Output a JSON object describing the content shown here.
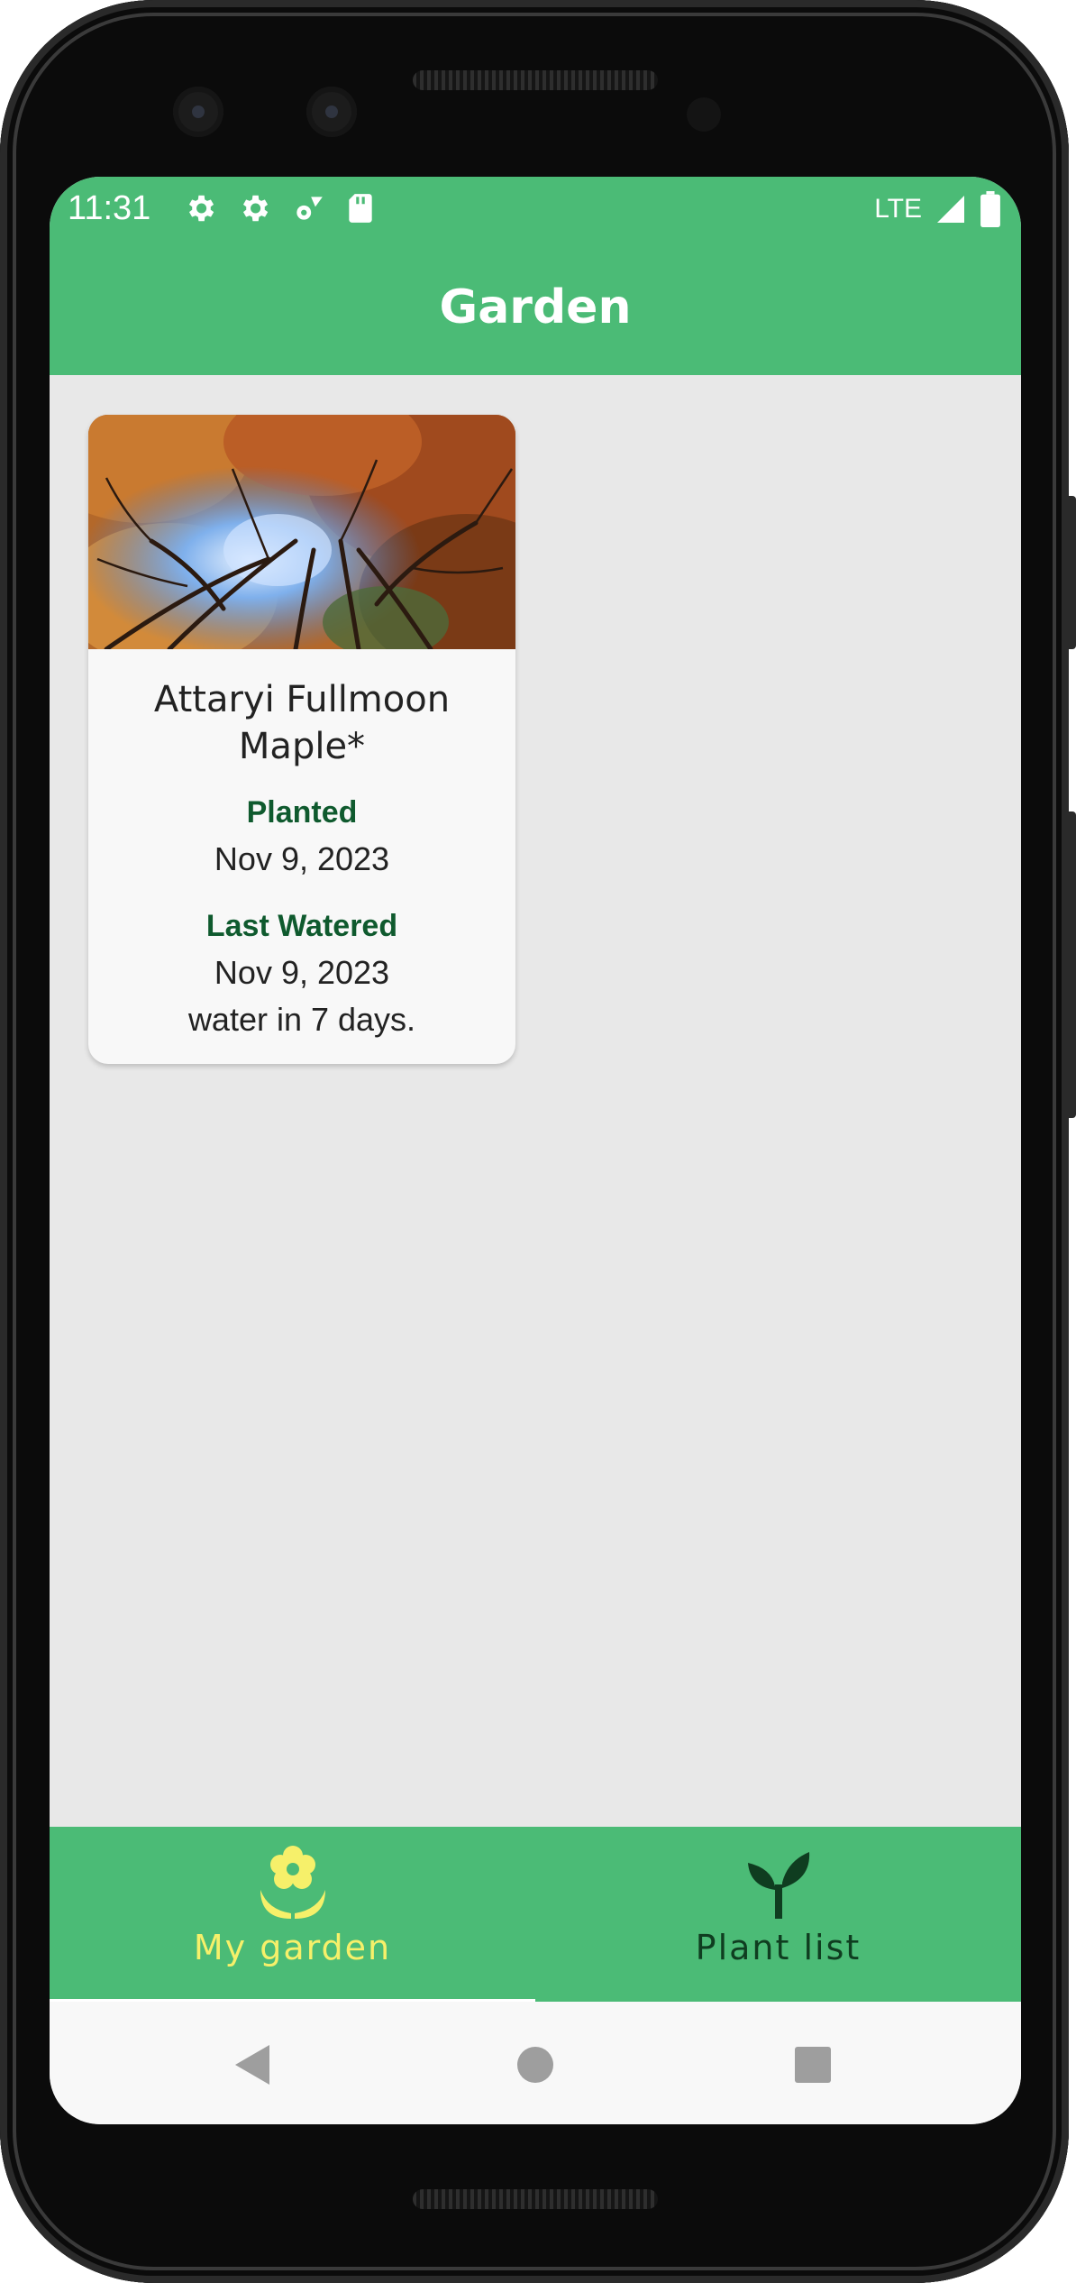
{
  "status_bar": {
    "time": "11:31",
    "network": "LTE"
  },
  "app_bar": {
    "title": "Garden"
  },
  "garden_card": {
    "plant_name": "Attaryi Fullmoon Maple*",
    "planted_label": "Planted",
    "planted_date": "Nov 9, 2023",
    "watered_label": "Last Watered",
    "watered_date": "Nov 9, 2023",
    "water_note": "water in 7 days."
  },
  "bottom_nav": {
    "items": [
      {
        "label": "My garden",
        "icon": "flower-icon",
        "selected": true
      },
      {
        "label": "Plant list",
        "icon": "sprout-icon",
        "selected": false
      }
    ]
  },
  "colors": {
    "primary": "#4bbb76",
    "selected_nav": "#f6f06a",
    "unselected_nav": "#0f3d20",
    "label_green": "#0f5a2e"
  }
}
